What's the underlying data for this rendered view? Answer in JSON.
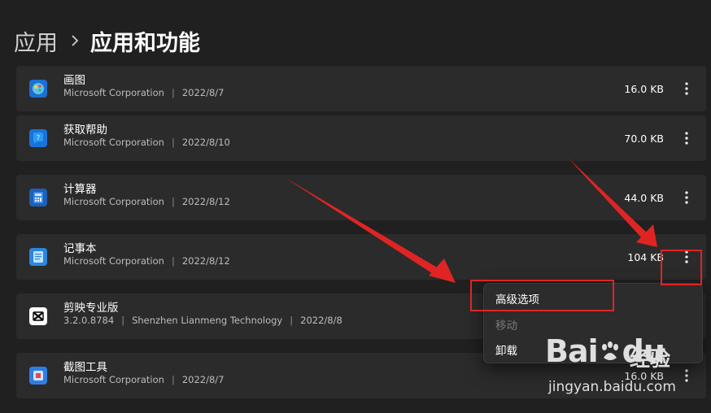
{
  "breadcrumb": {
    "root": "应用",
    "current": "应用和功能"
  },
  "apps": [
    {
      "name": "画图",
      "publisher": "Microsoft Corporation",
      "date": "2022/8/7",
      "size": "16.0 KB",
      "icon": "paint-icon"
    },
    {
      "name": "获取帮助",
      "publisher": "Microsoft Corporation",
      "date": "2022/8/10",
      "size": "70.0 KB",
      "icon": "get-help-icon"
    },
    {
      "name": "计算器",
      "publisher": "Microsoft Corporation",
      "date": "2022/8/12",
      "size": "44.0 KB",
      "icon": "calculator-icon"
    },
    {
      "name": "记事本",
      "publisher": "Microsoft Corporation",
      "date": "2022/8/12",
      "size": "104 KB",
      "icon": "notepad-icon"
    },
    {
      "name": "剪映专业版",
      "version": "3.2.0.8784",
      "publisher": "Shenzhen Lianmeng Technology",
      "date": "2022/8/8",
      "size": "",
      "icon": "capcut-icon"
    },
    {
      "name": "截图工具",
      "publisher": "Microsoft Corporation",
      "date": "2022/8/7",
      "size": "16.0 KB",
      "icon": "snipping-tool-icon"
    }
  ],
  "meta_separator": "|",
  "context_menu": {
    "items": [
      {
        "label": "高级选项",
        "enabled": true
      },
      {
        "label": "移动",
        "enabled": false
      },
      {
        "label": "卸载",
        "enabled": true
      }
    ]
  },
  "watermark": {
    "brand": "Bai",
    "brand_suffix": "du",
    "chinese": "经验",
    "url": "jingyan.baidu.com"
  },
  "colors": {
    "background": "#202020",
    "row_background": "#2b2b2b",
    "annotation_red": "#e02424",
    "menu_background": "#2c2c2c"
  }
}
